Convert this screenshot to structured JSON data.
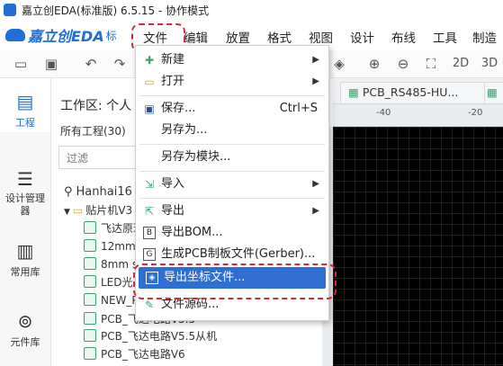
{
  "window": {
    "title": "嘉立创EDA(标准版) 6.5.15 - 协作模式"
  },
  "logo": {
    "text": "嘉立创EDA",
    "sub": "标"
  },
  "menubar": {
    "items": [
      "文件",
      "编辑",
      "放置",
      "格式",
      "视图",
      "设计",
      "布线",
      "工具",
      "制造"
    ]
  },
  "toolbar": {
    "zoom_2d": "2D",
    "zoom_3d": "3D"
  },
  "rail": {
    "items": [
      {
        "label": "工程",
        "icon": "folder-icon"
      },
      {
        "label": "设计管理器",
        "icon": "list-icon"
      },
      {
        "label": "常用库",
        "icon": "chip-icon"
      },
      {
        "label": "元件库",
        "icon": "search-component-icon"
      }
    ]
  },
  "panel": {
    "workspace": "工作区: 个人",
    "all_projects": "所有工程(30)",
    "filter_placeholder": "过滤",
    "tree": [
      "Hanhai16",
      "贴片机V3",
      "飞达原理",
      "12mm s",
      "8mm st",
      "LED光",
      "NEW_P",
      "PCB_飞达电路V5.5",
      "PCB_飞达电路V5.5从机",
      "PCB_飞达电路V6"
    ]
  },
  "editor": {
    "tab": "PCB_RS485-HU...",
    "ruler": [
      "-40",
      "-20"
    ]
  },
  "file_menu": {
    "items": [
      {
        "label": "新建",
        "shortcut": "",
        "submenu": true,
        "icon": "new-file-icon"
      },
      {
        "label": "打开",
        "shortcut": "",
        "submenu": true,
        "icon": "open-folder-icon"
      },
      {
        "label": "保存...",
        "shortcut": "Ctrl+S",
        "submenu": false,
        "icon": "save-icon"
      },
      {
        "label": "另存为...",
        "shortcut": "",
        "submenu": false,
        "icon": ""
      },
      {
        "label": "另存为模块...",
        "shortcut": "",
        "submenu": false,
        "icon": ""
      },
      {
        "label": "导入",
        "shortcut": "",
        "submenu": true,
        "icon": "import-icon"
      },
      {
        "label": "导出",
        "shortcut": "",
        "submenu": true,
        "icon": "export-icon"
      },
      {
        "label": "导出BOM...",
        "shortcut": "",
        "submenu": false,
        "icon": "bom-icon"
      },
      {
        "label": "生成PCB制板文件(Gerber)...",
        "shortcut": "",
        "submenu": false,
        "icon": "gerber-icon"
      },
      {
        "label": "导出坐标文件...",
        "shortcut": "",
        "submenu": false,
        "icon": "coordinate-file-icon"
      },
      {
        "label": "文件源码...",
        "shortcut": "",
        "submenu": false,
        "icon": "source-edit-icon"
      }
    ]
  },
  "colors": {
    "accent": "#2f6fd1",
    "highlight": "#d7263d",
    "brand": "#1f6fd6"
  }
}
